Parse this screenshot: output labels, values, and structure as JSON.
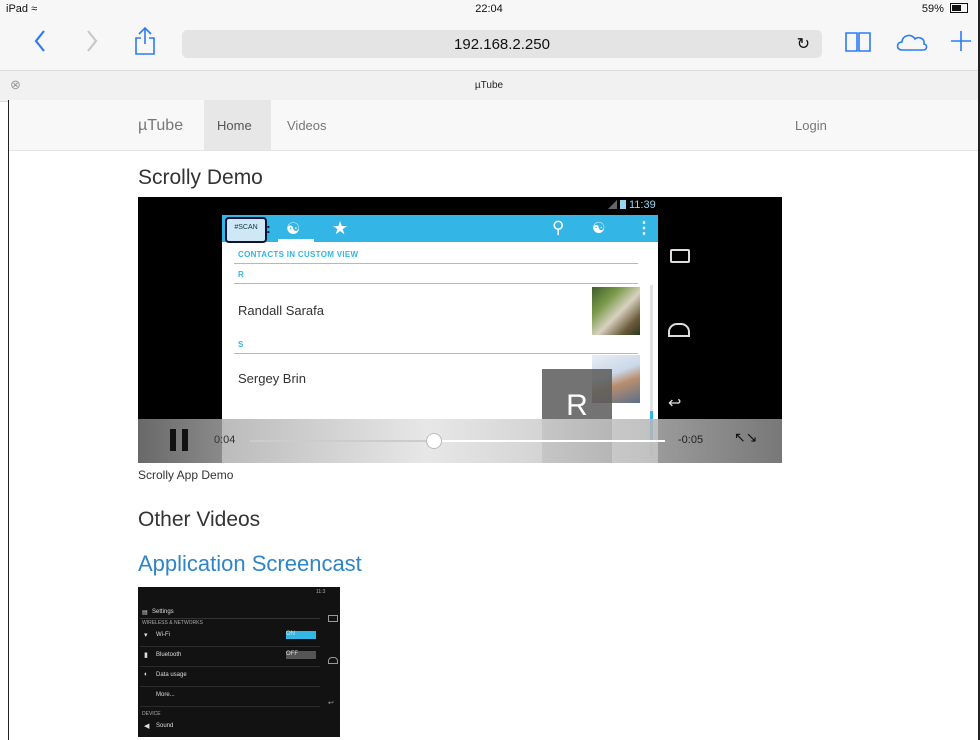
{
  "device_status": {
    "device": "iPad",
    "wifi_icon": "wifi-icon",
    "time": "22:04",
    "battery": "59%"
  },
  "browser": {
    "back_icon": "chevron-left-icon",
    "forward_icon": "chevron-right-icon",
    "share_icon": "share-icon",
    "url": "192.168.2.250",
    "reload_icon": "reload-icon",
    "bookmarks_icon": "book-icon",
    "cloud_icon": "cloud-icon",
    "new_tab_icon": "plus-icon",
    "tab_title": "µTube",
    "tab_close_icon": "close-icon",
    "accent_color": "#2b7cf6"
  },
  "navbar": {
    "brand": "µTube",
    "items": [
      {
        "label": "Home",
        "active": true
      },
      {
        "label": "Videos",
        "active": false
      }
    ],
    "login": "Login"
  },
  "main": {
    "title": "Scrolly Demo",
    "video": {
      "phone_time": "11:39",
      "app": {
        "logo": "#SCAN",
        "section_header": "CONTACTS IN CUSTOM VIEW",
        "groups": [
          {
            "letter": "R",
            "contact": "Randall Sarafa"
          },
          {
            "letter": "S",
            "contact": "Sergey Brin"
          }
        ],
        "fast_scroll_letter": "R",
        "accent_color": "#33b5e5"
      },
      "current_time": "0:04",
      "remaining_time": "-0:05",
      "progress": 0.44,
      "pause_icon": "pause-icon",
      "fullscreen_icon": "fullscreen-icon"
    },
    "caption": "Scrolly App Demo",
    "other_title": "Other Videos",
    "link": {
      "label": "Application Screencast",
      "color": "#2f85c8"
    },
    "thumbnail": {
      "status_time": "11:3",
      "header": "Settings",
      "section": "WIRELESS & NETWORKS",
      "rows": [
        {
          "label": "Wi-Fi",
          "toggle": "ON"
        },
        {
          "label": "Bluetooth",
          "toggle": "OFF"
        },
        {
          "label": "Data usage"
        },
        {
          "label": "More..."
        }
      ],
      "section2": "DEVICE",
      "last_row": "Sound"
    }
  }
}
